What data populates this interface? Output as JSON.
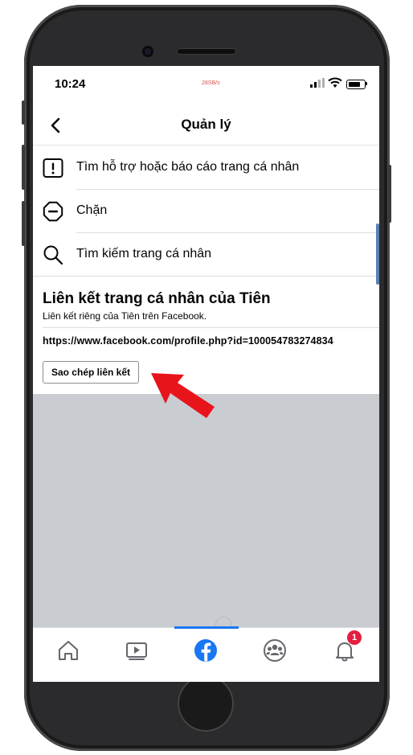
{
  "status_bar": {
    "time": "10:24",
    "net_speed": "28SB/s"
  },
  "nav": {
    "title": "Quản lý",
    "back_icon": "chevron-left-icon"
  },
  "menu": {
    "items": [
      {
        "label": "Tìm hỗ trợ hoặc báo cáo trang cá nhân",
        "icon": "report-icon"
      },
      {
        "label": "Chặn",
        "icon": "block-icon"
      },
      {
        "label": "Tìm kiếm trang cá nhân",
        "icon": "search-icon"
      }
    ]
  },
  "profile_link": {
    "title": "Liên kết trang cá nhân của Tiên",
    "subtitle": "Liên kết riêng của Tiên trên Facebook.",
    "url": "https://www.facebook.com/profile.php?id=100054783274834",
    "copy_button": "Sao chép liên kết"
  },
  "tabbar": {
    "tabs": [
      {
        "name": "home",
        "icon": "home-icon"
      },
      {
        "name": "watch",
        "icon": "video-icon"
      },
      {
        "name": "facebook",
        "icon": "facebook-logo-icon",
        "active": true
      },
      {
        "name": "groups",
        "icon": "groups-icon"
      },
      {
        "name": "notifications",
        "icon": "bell-icon",
        "badge": "1"
      }
    ]
  },
  "colors": {
    "accent": "#1877f2",
    "badge": "#e41e3f",
    "annotation_arrow": "#e8141c",
    "empty_area": "#c9ccd1"
  }
}
